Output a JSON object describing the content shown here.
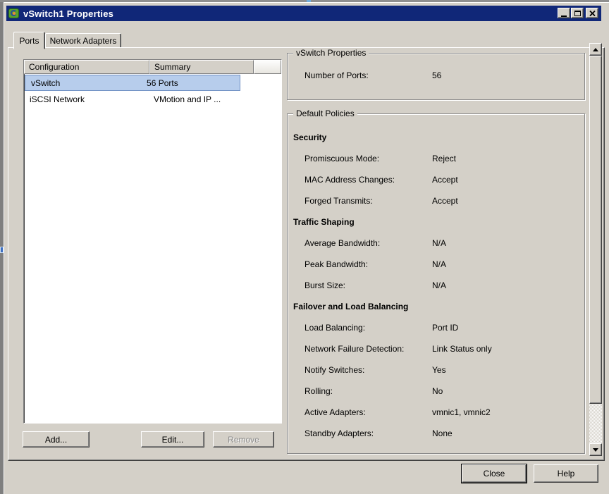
{
  "window": {
    "title": "vSwitch1 Properties"
  },
  "tabs": [
    {
      "label": "Ports",
      "active": true
    },
    {
      "label": "Network Adapters",
      "active": false
    }
  ],
  "port_list": {
    "columns": [
      "Configuration",
      "Summary"
    ],
    "rows": [
      {
        "configuration": "vSwitch",
        "summary": "56 Ports",
        "selected": true
      },
      {
        "configuration": "iSCSI Network",
        "summary": "VMotion and IP ...",
        "selected": false
      }
    ],
    "buttons": {
      "add": "Add...",
      "edit": "Edit...",
      "remove": "Remove"
    }
  },
  "vswitch_properties": {
    "group_title": "vSwitch Properties",
    "rows": [
      {
        "label": "Number of Ports:",
        "value": "56"
      }
    ]
  },
  "default_policies": {
    "group_title": "Default Policies",
    "sections": [
      {
        "header": "Security",
        "rows": [
          {
            "label": "Promiscuous Mode:",
            "value": "Reject"
          },
          {
            "label": "MAC Address Changes:",
            "value": "Accept"
          },
          {
            "label": "Forged Transmits:",
            "value": "Accept"
          }
        ]
      },
      {
        "header": "Traffic Shaping",
        "rows": [
          {
            "label": "Average Bandwidth:",
            "value": "N/A"
          },
          {
            "label": "Peak Bandwidth:",
            "value": "N/A"
          },
          {
            "label": "Burst Size:",
            "value": "N/A"
          }
        ]
      },
      {
        "header": "Failover and Load Balancing",
        "rows": [
          {
            "label": "Load Balancing:",
            "value": "Port ID"
          },
          {
            "label": "Network Failure Detection:",
            "value": "Link Status only"
          },
          {
            "label": "Notify Switches:",
            "value": "Yes"
          },
          {
            "label": "Rolling:",
            "value": "No"
          },
          {
            "label": "Active Adapters:",
            "value": "vmnic1, vmnic2"
          },
          {
            "label": "Standby Adapters:",
            "value": "None"
          }
        ]
      }
    ]
  },
  "footer": {
    "close": "Close",
    "help": "Help"
  },
  "colors": {
    "titlebar": "#102778",
    "selection_bg": "#B7CDEC",
    "selection_border": "#7191C4",
    "face": "#D4D0C8"
  }
}
